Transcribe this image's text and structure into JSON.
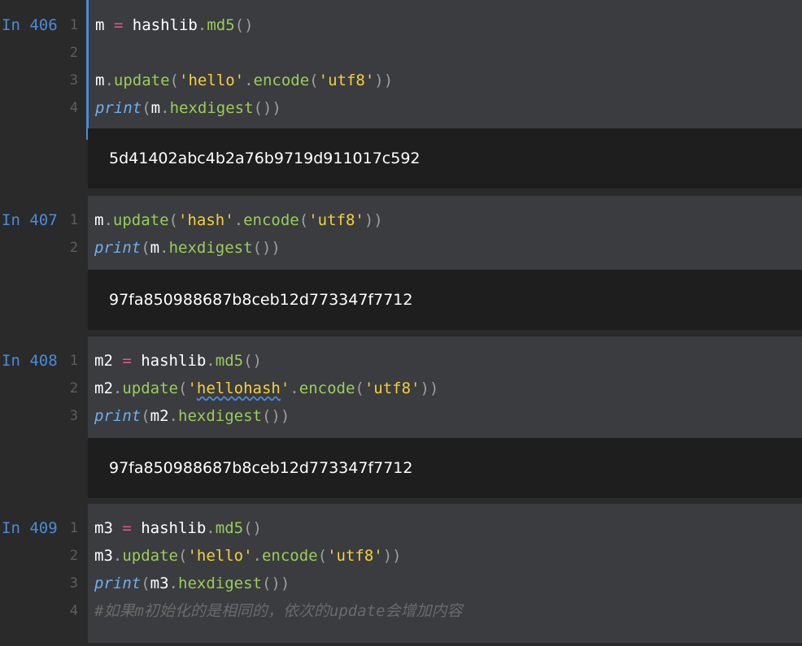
{
  "cells": [
    {
      "prompt": "In 406",
      "line_numbers": [
        "1",
        "2",
        "3",
        "4"
      ],
      "lines": [
        [
          [
            "var",
            "m"
          ],
          [
            "op",
            " = "
          ],
          [
            "mod",
            "hashlib"
          ],
          [
            "dot",
            "."
          ],
          [
            "attr",
            "md5"
          ],
          [
            "paren",
            "()"
          ]
        ],
        [],
        [
          [
            "var",
            "m"
          ],
          [
            "dot",
            "."
          ],
          [
            "attr",
            "update"
          ],
          [
            "paren",
            "("
          ],
          [
            "str",
            "'hello'"
          ],
          [
            "dot",
            "."
          ],
          [
            "attr",
            "encode"
          ],
          [
            "paren",
            "("
          ],
          [
            "str",
            "'utf8'"
          ],
          [
            "paren",
            "))"
          ]
        ],
        [
          [
            "builtin",
            "print"
          ],
          [
            "paren",
            "("
          ],
          [
            "var",
            "m"
          ],
          [
            "dot",
            "."
          ],
          [
            "attr",
            "hexdigest"
          ],
          [
            "paren",
            "())"
          ]
        ]
      ],
      "output": "5d41402abc4b2a76b9719d911017c592"
    },
    {
      "prompt": "In 407",
      "line_numbers": [
        "1",
        "2"
      ],
      "lines": [
        [
          [
            "var",
            "m"
          ],
          [
            "dot",
            "."
          ],
          [
            "attr",
            "update"
          ],
          [
            "paren",
            "("
          ],
          [
            "str",
            "'hash'"
          ],
          [
            "dot",
            "."
          ],
          [
            "attr",
            "encode"
          ],
          [
            "paren",
            "("
          ],
          [
            "str",
            "'utf8'"
          ],
          [
            "paren",
            "))"
          ]
        ],
        [
          [
            "builtin",
            "print"
          ],
          [
            "paren",
            "("
          ],
          [
            "var",
            "m"
          ],
          [
            "dot",
            "."
          ],
          [
            "attr",
            "hexdigest"
          ],
          [
            "paren",
            "())"
          ]
        ]
      ],
      "output": "97fa850988687b8ceb12d773347f7712"
    },
    {
      "prompt": "In 408",
      "line_numbers": [
        "1",
        "2",
        "3"
      ],
      "lines": [
        [
          [
            "var",
            "m2"
          ],
          [
            "op",
            " = "
          ],
          [
            "mod",
            "hashlib"
          ],
          [
            "dot",
            "."
          ],
          [
            "attr",
            "md5"
          ],
          [
            "paren",
            "()"
          ]
        ],
        [
          [
            "var",
            "m2"
          ],
          [
            "dot",
            "."
          ],
          [
            "attr",
            "update"
          ],
          [
            "paren",
            "("
          ],
          [
            "str",
            "'"
          ],
          [
            "strsq",
            "hellohash"
          ],
          [
            "str",
            "'"
          ],
          [
            "dot",
            "."
          ],
          [
            "attr",
            "encode"
          ],
          [
            "paren",
            "("
          ],
          [
            "str",
            "'utf8'"
          ],
          [
            "paren",
            "))"
          ]
        ],
        [
          [
            "builtin",
            "print"
          ],
          [
            "paren",
            "("
          ],
          [
            "var",
            "m2"
          ],
          [
            "dot",
            "."
          ],
          [
            "attr",
            "hexdigest"
          ],
          [
            "paren",
            "())"
          ]
        ]
      ],
      "output": "97fa850988687b8ceb12d773347f7712"
    },
    {
      "prompt": "In 409",
      "line_numbers": [
        "1",
        "2",
        "3",
        "4"
      ],
      "lines": [
        [
          [
            "var",
            "m3"
          ],
          [
            "op",
            " = "
          ],
          [
            "mod",
            "hashlib"
          ],
          [
            "dot",
            "."
          ],
          [
            "attr",
            "md5"
          ],
          [
            "paren",
            "()"
          ]
        ],
        [
          [
            "var",
            "m3"
          ],
          [
            "dot",
            "."
          ],
          [
            "attr",
            "update"
          ],
          [
            "paren",
            "("
          ],
          [
            "str",
            "'hello'"
          ],
          [
            "dot",
            "."
          ],
          [
            "attr",
            "encode"
          ],
          [
            "paren",
            "("
          ],
          [
            "str",
            "'utf8'"
          ],
          [
            "paren",
            "))"
          ]
        ],
        [
          [
            "builtin",
            "print"
          ],
          [
            "paren",
            "("
          ],
          [
            "var",
            "m3"
          ],
          [
            "dot",
            "."
          ],
          [
            "attr",
            "hexdigest"
          ],
          [
            "paren",
            "())"
          ]
        ],
        [
          [
            "comment",
            "#如果m初始化的是相同的，依次的update会增加内容"
          ]
        ]
      ],
      "output": null
    }
  ]
}
